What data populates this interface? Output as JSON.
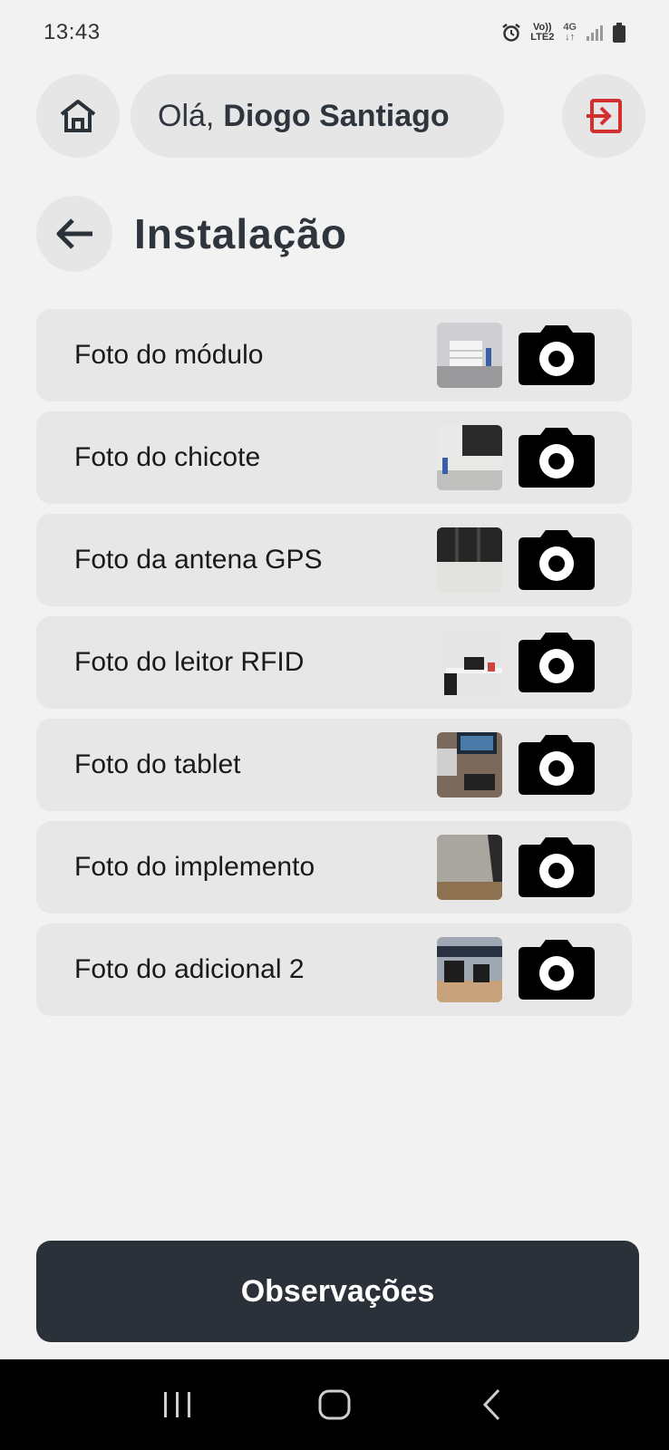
{
  "status_bar": {
    "time": "13:43",
    "network_top": "Vo))",
    "network_bottom": "LTE2",
    "signal_type": "4G"
  },
  "header": {
    "greeting": "Olá,",
    "user_name": "Diogo Santiago",
    "home_icon": "home-icon",
    "logout_icon": "logout-icon",
    "logout_color": "#d32f2f"
  },
  "page": {
    "title": "Instalação",
    "back_icon": "arrow-left-icon"
  },
  "photo_items": [
    {
      "label": "Foto do módulo"
    },
    {
      "label": "Foto do chicote"
    },
    {
      "label": "Foto da antena GPS"
    },
    {
      "label": "Foto do leitor RFID"
    },
    {
      "label": "Foto do tablet"
    },
    {
      "label": "Foto do implemento"
    },
    {
      "label": "Foto do adicional 2"
    }
  ],
  "footer": {
    "observations_label": "Observações",
    "button_color": "#2b3139"
  },
  "nav": {
    "recent_icon": "recent-apps-icon",
    "home_icon": "home-circle-icon",
    "back_icon": "back-chevron-icon"
  }
}
